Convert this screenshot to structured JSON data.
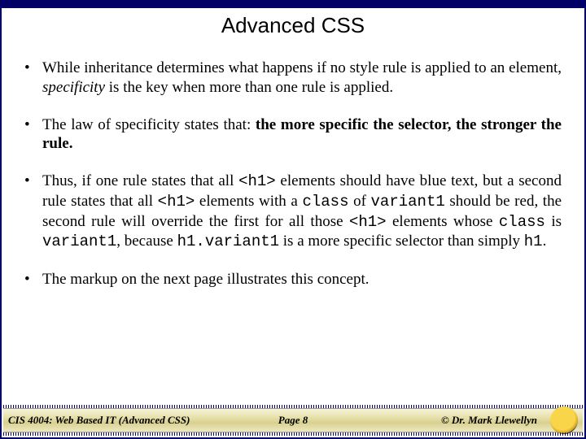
{
  "title": "Advanced CSS",
  "bullets": {
    "b1": {
      "pre": "While inheritance determines what happens if no style rule is applied to an element, ",
      "ital": "specificity",
      "post": " is the key when more than one rule is applied."
    },
    "b2": {
      "pre": "The law of specificity states that: ",
      "bold": "the more specific the selector, the stronger the rule."
    },
    "b3": {
      "t1": "Thus, if one rule states that all ",
      "c1": "<h1>",
      "t2": "  elements should have blue text, but a second rule states that all ",
      "c2": "<h1>",
      "t3": "  elements with a ",
      "c3": "class",
      "t4": " of ",
      "c4": "variant1",
      "t5": " should be red, the second rule will override the first for all those ",
      "c5": "<h1>",
      "t6": "  elements whose ",
      "c6": "class",
      "t7": " is ",
      "c7": "variant1",
      "t8": ", because ",
      "c8": "h1.variant1",
      "t9": " is a more specific selector than simply ",
      "c9": "h1",
      "t10": "."
    },
    "b4": "The markup on the next page illustrates this concept."
  },
  "footer": {
    "left": "CIS 4004: Web Based IT (Advanced CSS)",
    "center": "Page 8",
    "right": "© Dr. Mark Llewellyn"
  }
}
